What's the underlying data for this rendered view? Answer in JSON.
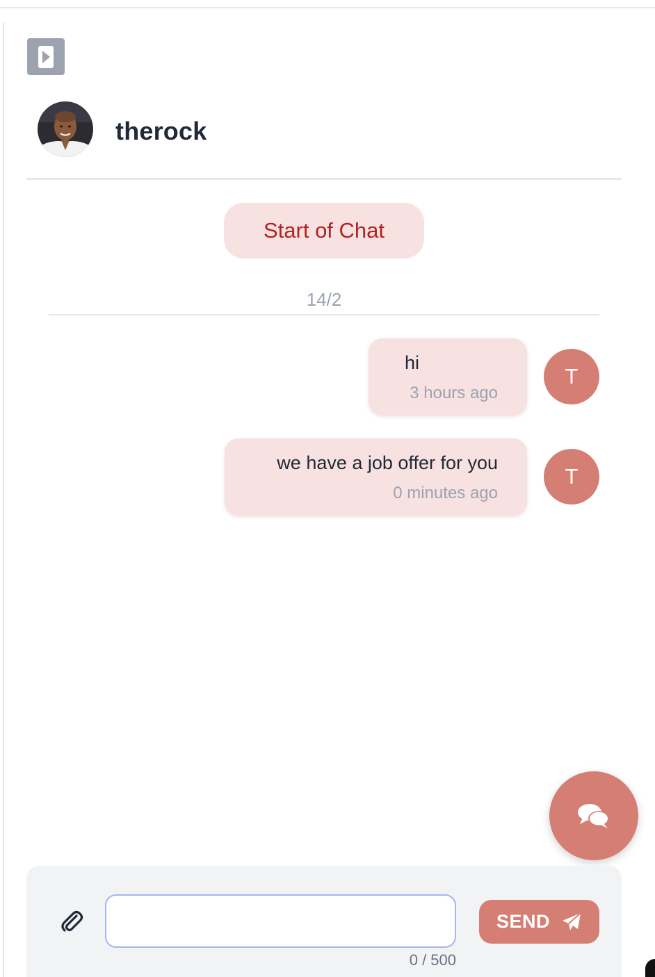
{
  "header": {
    "toggle_icon": "play-square-icon",
    "username": "therock",
    "avatar_icon": "profile-photo"
  },
  "chat": {
    "start_label": "Start of Chat",
    "date_label": "14/2",
    "messages": [
      {
        "text": "hi",
        "time": "3 hours ago",
        "avatar_letter": "T"
      },
      {
        "text": "we have a job offer for you",
        "time": "0 minutes ago",
        "avatar_letter": "T"
      }
    ]
  },
  "fab": {
    "icon": "chat-bubbles-icon"
  },
  "composer": {
    "attach_icon": "paperclip-icon",
    "input_value": "",
    "counter": "0 / 500",
    "send_label": "SEND",
    "send_icon": "paper-plane-icon"
  },
  "colors": {
    "accent": "#d57f74",
    "bubble": "#f7e1e1",
    "start_text": "#b22222",
    "muted": "#9ca3af"
  }
}
